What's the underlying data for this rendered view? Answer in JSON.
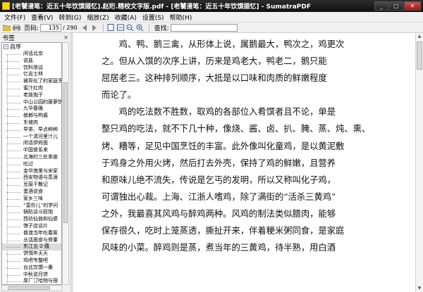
{
  "window": {
    "title": "[老饕漫笔：近五十年饮馔掇忆].赵珩.精校文字版.pdf - [老饕漫笔：近五十年饮馔掇忆] - SumatraPDF",
    "buttons": {
      "minimize": "_",
      "maximize": "□",
      "close": "✕"
    }
  },
  "menu": [
    "文件(F)",
    "查看(V)",
    "转到(G)",
    "缩放(Z)",
    "收藏(A)",
    "设置(S)",
    "帮助(H)"
  ],
  "toolbar": {
    "page_label": "页码:",
    "page_value": "135",
    "page_total": "/ 290",
    "find_label": "查找:",
    "find_value": "",
    "icons": [
      "open-icon",
      "print-icon",
      "prev-page-icon",
      "next-page-icon",
      "fit-page-icon",
      "fit-width-icon",
      "zoom-out-icon",
      "zoom-in-icon"
    ]
  },
  "sidebar": {
    "title": "书签",
    "close": "✕",
    "root_label": "自序",
    "items": [
      "闲话北京",
      "说盐",
      "饮料琐谈",
      "忆吉士林",
      "被异化了的家庭烹饪",
      "蜜汁红肉",
      "老妓抱子",
      "中山公园的藤萝饼",
      "九华春晚",
      "槟榔与枸酱",
      "东坡肉",
      "早茶、早点种种",
      "一个清河里汁儿",
      "闲话伊府面",
      "中国食系来",
      "北海的三处茶座",
      "吃过",
      "金华馆里与宋家",
      "西安物语与蒸滴",
      "豆腐干散记",
      "蛋酒说食",
      "家乡三味",
      "“富你儿”的学问",
      "锅贴谈斗殴炮",
      "西坊仙翁和仙婆",
      "馆子店谈片",
      "普渡当年吃春筹",
      "丛话面食与骨董",
      "东江五·2·蕴",
      "饼饵年夭天",
      "鸡吧专整吧",
      "台北饮馔一番",
      "中秋说月饼",
      "厚厂汀哈物与宿",
      "二五五是白鸡"
    ],
    "selected_index": 28
  },
  "document": {
    "paragraphs": [
      {
        "lines": [
          "鸡、鸭、鹅三禽，从形体上说，属鹅最大，鸭次之，鸡更次",
          "之。但从入馔的次序上讲，历来是鸡老大，鸭老二，鹅只能",
          "屈居老三。这种排列顺序，大抵是以口味和肉质的鲜嫩程度",
          "而论了。"
        ]
      },
      {
        "lines": [
          "鸡的吃法数不胜数，取鸡的各部位入肴馔者且不论，单是",
          "整只鸡的吃法，就不下几十种，像烧、酱、卤、扒、腌、蒸、炖、熏、",
          "烤、糟等，足见中国烹饪的丰富。此外像叫化童鸡，是以黄泥敷",
          "于鸡身之外用火烤，然后打去外壳，保持了鸡的鲜嫩，且营养",
          "和原味儿绝不流失，传说是乞丐的发明，所以又称叫化子鸡，",
          "可谓独出心裁。上海、江浙人嗜鸡，除了满街的“活杀三黄鸡”",
          "之外，我最喜其风鸡与醉鸡两种。风鸡的制法类似腊肉，能够",
          "保存很久，吃时上笼蒸透，撕扯开来，伴着粳米粥同食，是家庭",
          "风味的小菜。醉鸡则是蒸，煮当年的三黄鸡，待半熟，用白酒"
        ]
      }
    ]
  }
}
